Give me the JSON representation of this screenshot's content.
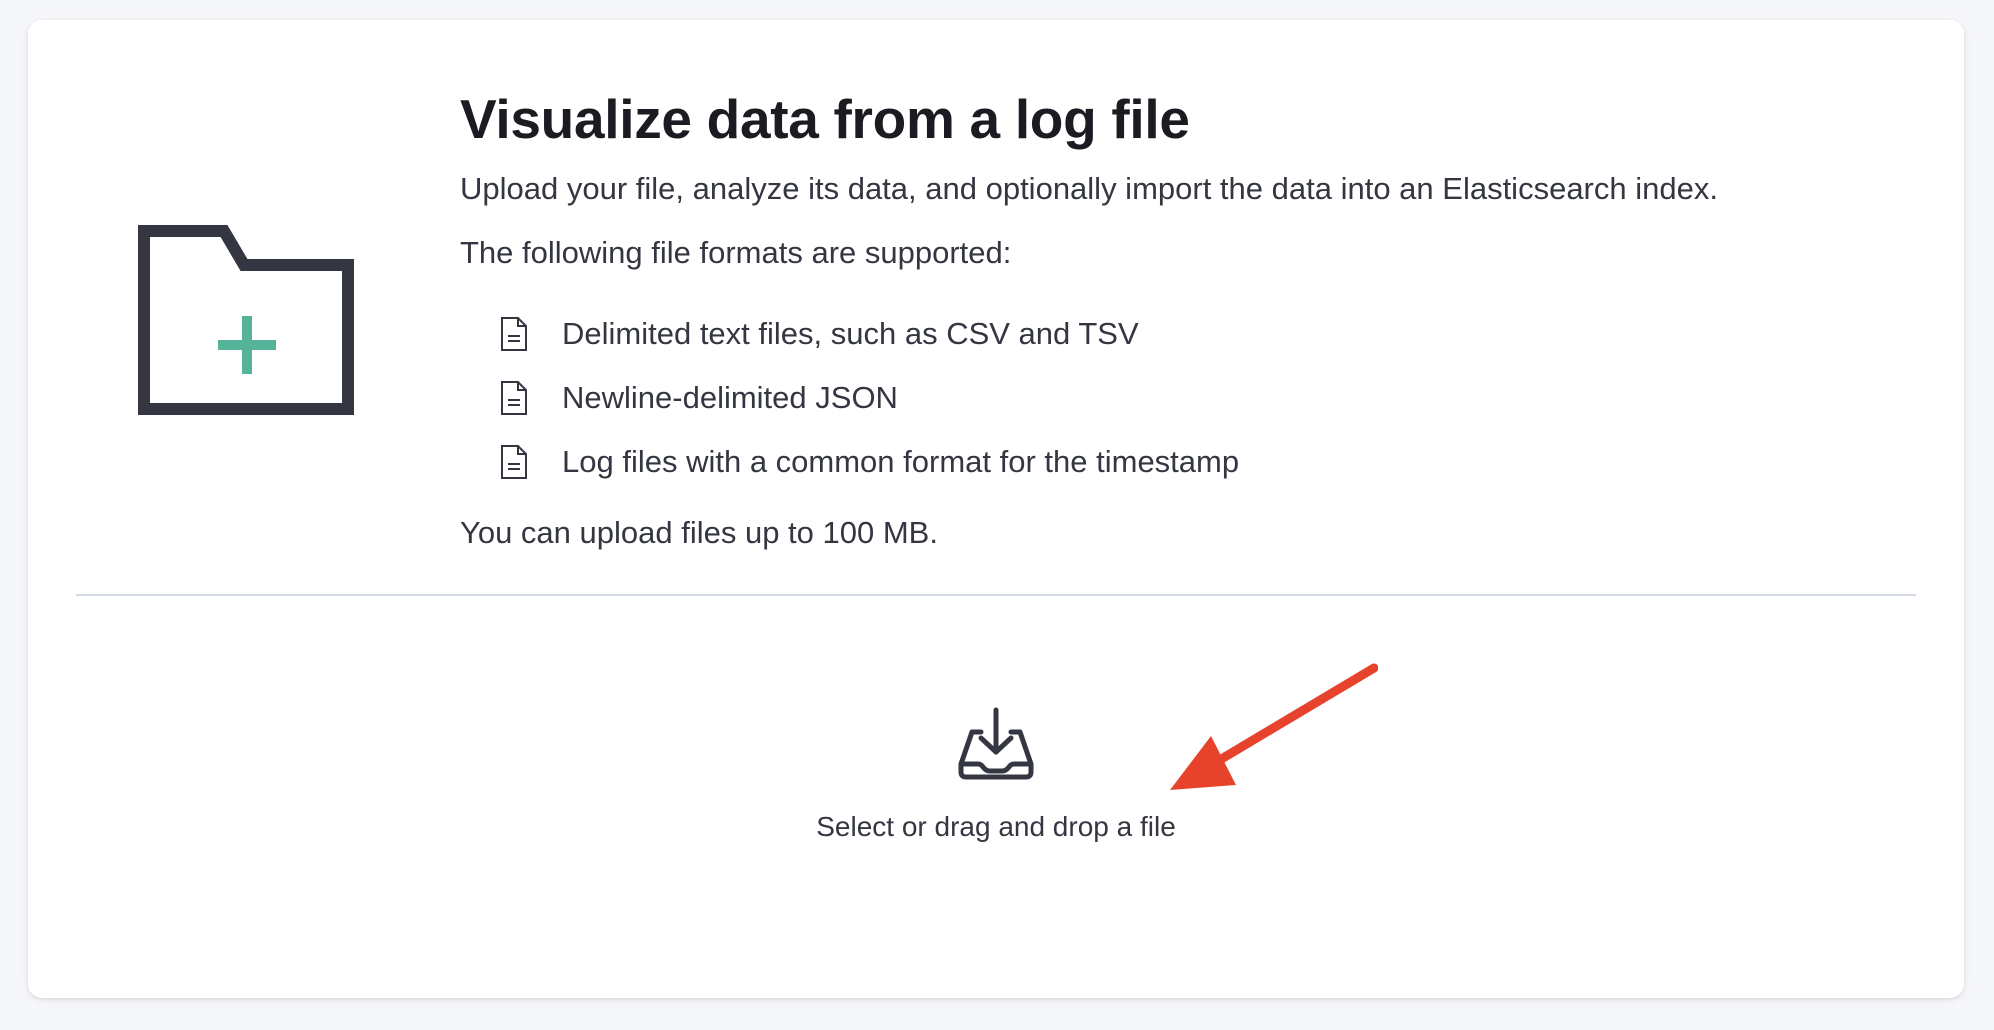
{
  "page": {
    "title": "Visualize data from a log file",
    "subtitle": "Upload your file, analyze its data, and optionally import the data into an Elasticsearch index.",
    "formats_intro": "The following file formats are supported:",
    "formats": [
      {
        "label": "Delimited text files, such as CSV and TSV",
        "icon": "document-icon"
      },
      {
        "label": "Newline-delimited JSON",
        "icon": "document-icon"
      },
      {
        "label": "Log files with a common format for the timestamp",
        "icon": "document-icon"
      }
    ],
    "size_note": "You can upload files up to 100 MB."
  },
  "hero": {
    "icon": "folder-add-icon",
    "colors": {
      "outline": "#343741",
      "plus": "#54b399"
    }
  },
  "dropzone": {
    "icon": "upload-tray-icon",
    "label": "Select or drag and drop a file"
  },
  "annotation": {
    "icon": "red-arrow-icon",
    "color": "#e7432c"
  }
}
